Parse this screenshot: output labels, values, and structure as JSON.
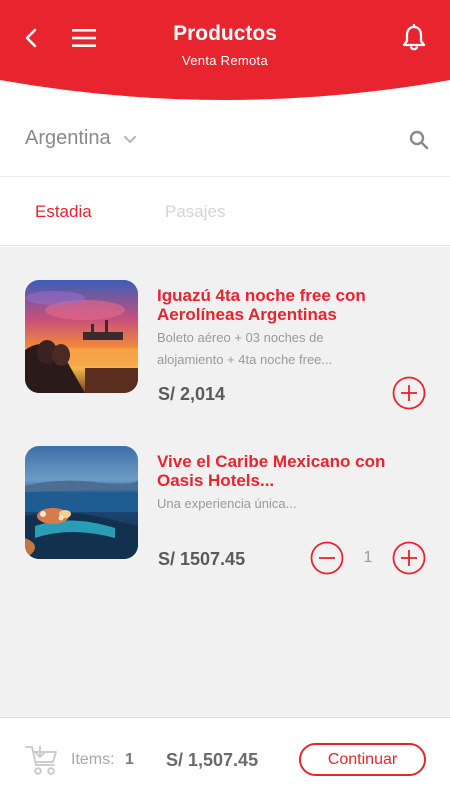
{
  "header": {
    "title": "Productos",
    "subtitle": "Venta Remota",
    "accent_color": "#e8242f",
    "icons": [
      "back-arrow-icon",
      "hamburger-menu-icon",
      "bell-icon"
    ]
  },
  "filter": {
    "country": "Argentina",
    "icons": [
      "chevron-down-icon",
      "search-icon"
    ]
  },
  "tabs": [
    {
      "label": "Estadia",
      "active": true
    },
    {
      "label": "Pasajes",
      "active": false
    }
  ],
  "products": [
    {
      "title": "Iguazú 4ta noche free con Aerolíneas Argentinas",
      "description": "Boleto aéreo + 03 noches de alojamiento + 4ta noche free...",
      "price": "S/ 2,014",
      "quantity": null,
      "thumbnail": "sunset-beach-couple-image"
    },
    {
      "title": "Vive el Caribe Mexicano con Oasis Hotels...",
      "description": "Una experiencia única...",
      "price": "S/ 1507.45",
      "quantity": "1",
      "thumbnail": "caribbean-resort-pool-image"
    }
  ],
  "footer": {
    "items_label": "Items:",
    "items_count": "1",
    "total": "S/ 1,507.45",
    "continue_label": "Continuar",
    "icons": [
      "shopping-cart-icon"
    ]
  }
}
